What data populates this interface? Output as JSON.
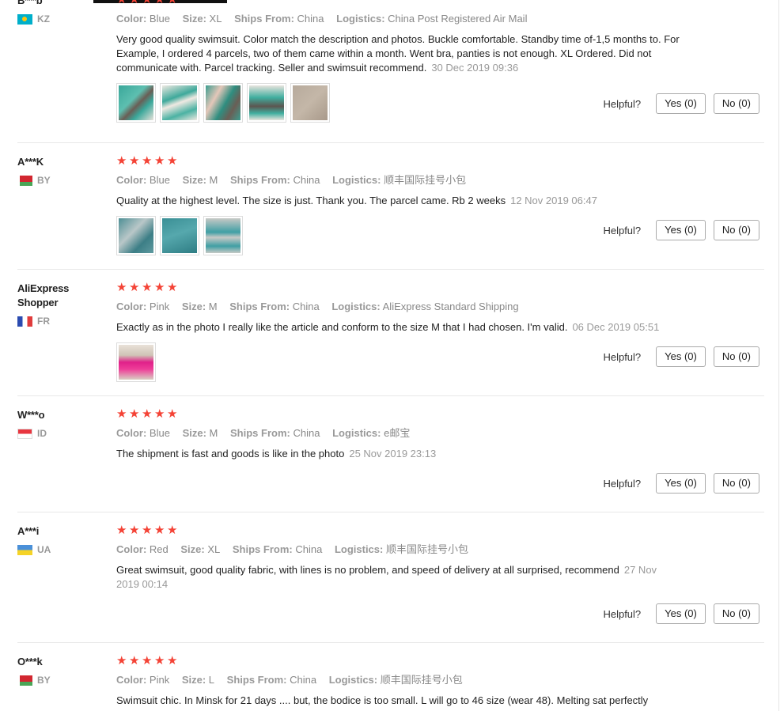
{
  "reviews": [
    {
      "user": "B***b",
      "country": "KZ",
      "flag": "kz",
      "color": "Blue",
      "size": "XL",
      "ships_from": "China",
      "logistics": "China Post Registered Air Mail",
      "text": "Very good quality swimsuit. Color match the description and photos. Buckle comfortable. Standby time of-1,5 months to. For Example, I ordered 4 parcels, two of them came within a month. Went bra, panties is not enough. XL Ordered. Did not communicate with. Parcel tracking. Seller and swimsuit recommend.",
      "date": "30 Dec 2019 09:36",
      "yes": "Yes (0)",
      "no": "No (0)"
    },
    {
      "user": "A***K",
      "country": "BY",
      "flag": "by",
      "color": "Blue",
      "size": "M",
      "ships_from": "China",
      "logistics": "顺丰国际挂号小包",
      "text": "Quality at the highest level. The size is just. Thank you. The parcel came. Rb 2 weeks",
      "date": "12 Nov 2019 06:47",
      "yes": "Yes (0)",
      "no": "No (0)"
    },
    {
      "user": "AliExpress Shopper",
      "country": "FR",
      "flag": "fr",
      "color": "Pink",
      "size": "M",
      "ships_from": "China",
      "logistics": "AliExpress Standard Shipping",
      "text": "Exactly as in the photo I really like the article and conform to the size M that I had chosen. I'm valid.",
      "date": "06 Dec 2019 05:51",
      "yes": "Yes (0)",
      "no": "No (0)"
    },
    {
      "user": "W***o",
      "country": "ID",
      "flag": "id",
      "color": "Blue",
      "size": "M",
      "ships_from": "China",
      "logistics": "e邮宝",
      "text": "The shipment is fast and goods is like in the photo",
      "date": "25 Nov 2019 23:13",
      "yes": "Yes (0)",
      "no": "No (0)"
    },
    {
      "user": "A***i",
      "country": "UA",
      "flag": "ua",
      "color": "Red",
      "size": "XL",
      "ships_from": "China",
      "logistics": "顺丰国际挂号小包",
      "text": "Great swimsuit, good quality fabric, with lines is no problem, and speed of delivery at all surprised, recommend",
      "date": "27 Nov 2019 00:14",
      "yes": "Yes (0)",
      "no": "No (0)"
    },
    {
      "user": "O***k",
      "country": "BY",
      "flag": "by",
      "color": "Pink",
      "size": "L",
      "ships_from": "China",
      "logistics": "顺丰国际挂号小包",
      "text": "Swimsuit chic. In Minsk for 21 days .... but, the bodice is too small. L will go to 46 size (wear 48). Melting sat perfectly",
      "date": "",
      "yes": "",
      "no": ""
    }
  ],
  "labels": {
    "color": "Color:",
    "size": "Size:",
    "ships_from": "Ships From:",
    "logistics": "Logistics:",
    "helpful": "Helpful?"
  },
  "rating_stars": 5,
  "colors": {
    "star": "#f44336",
    "date": "#999999"
  }
}
